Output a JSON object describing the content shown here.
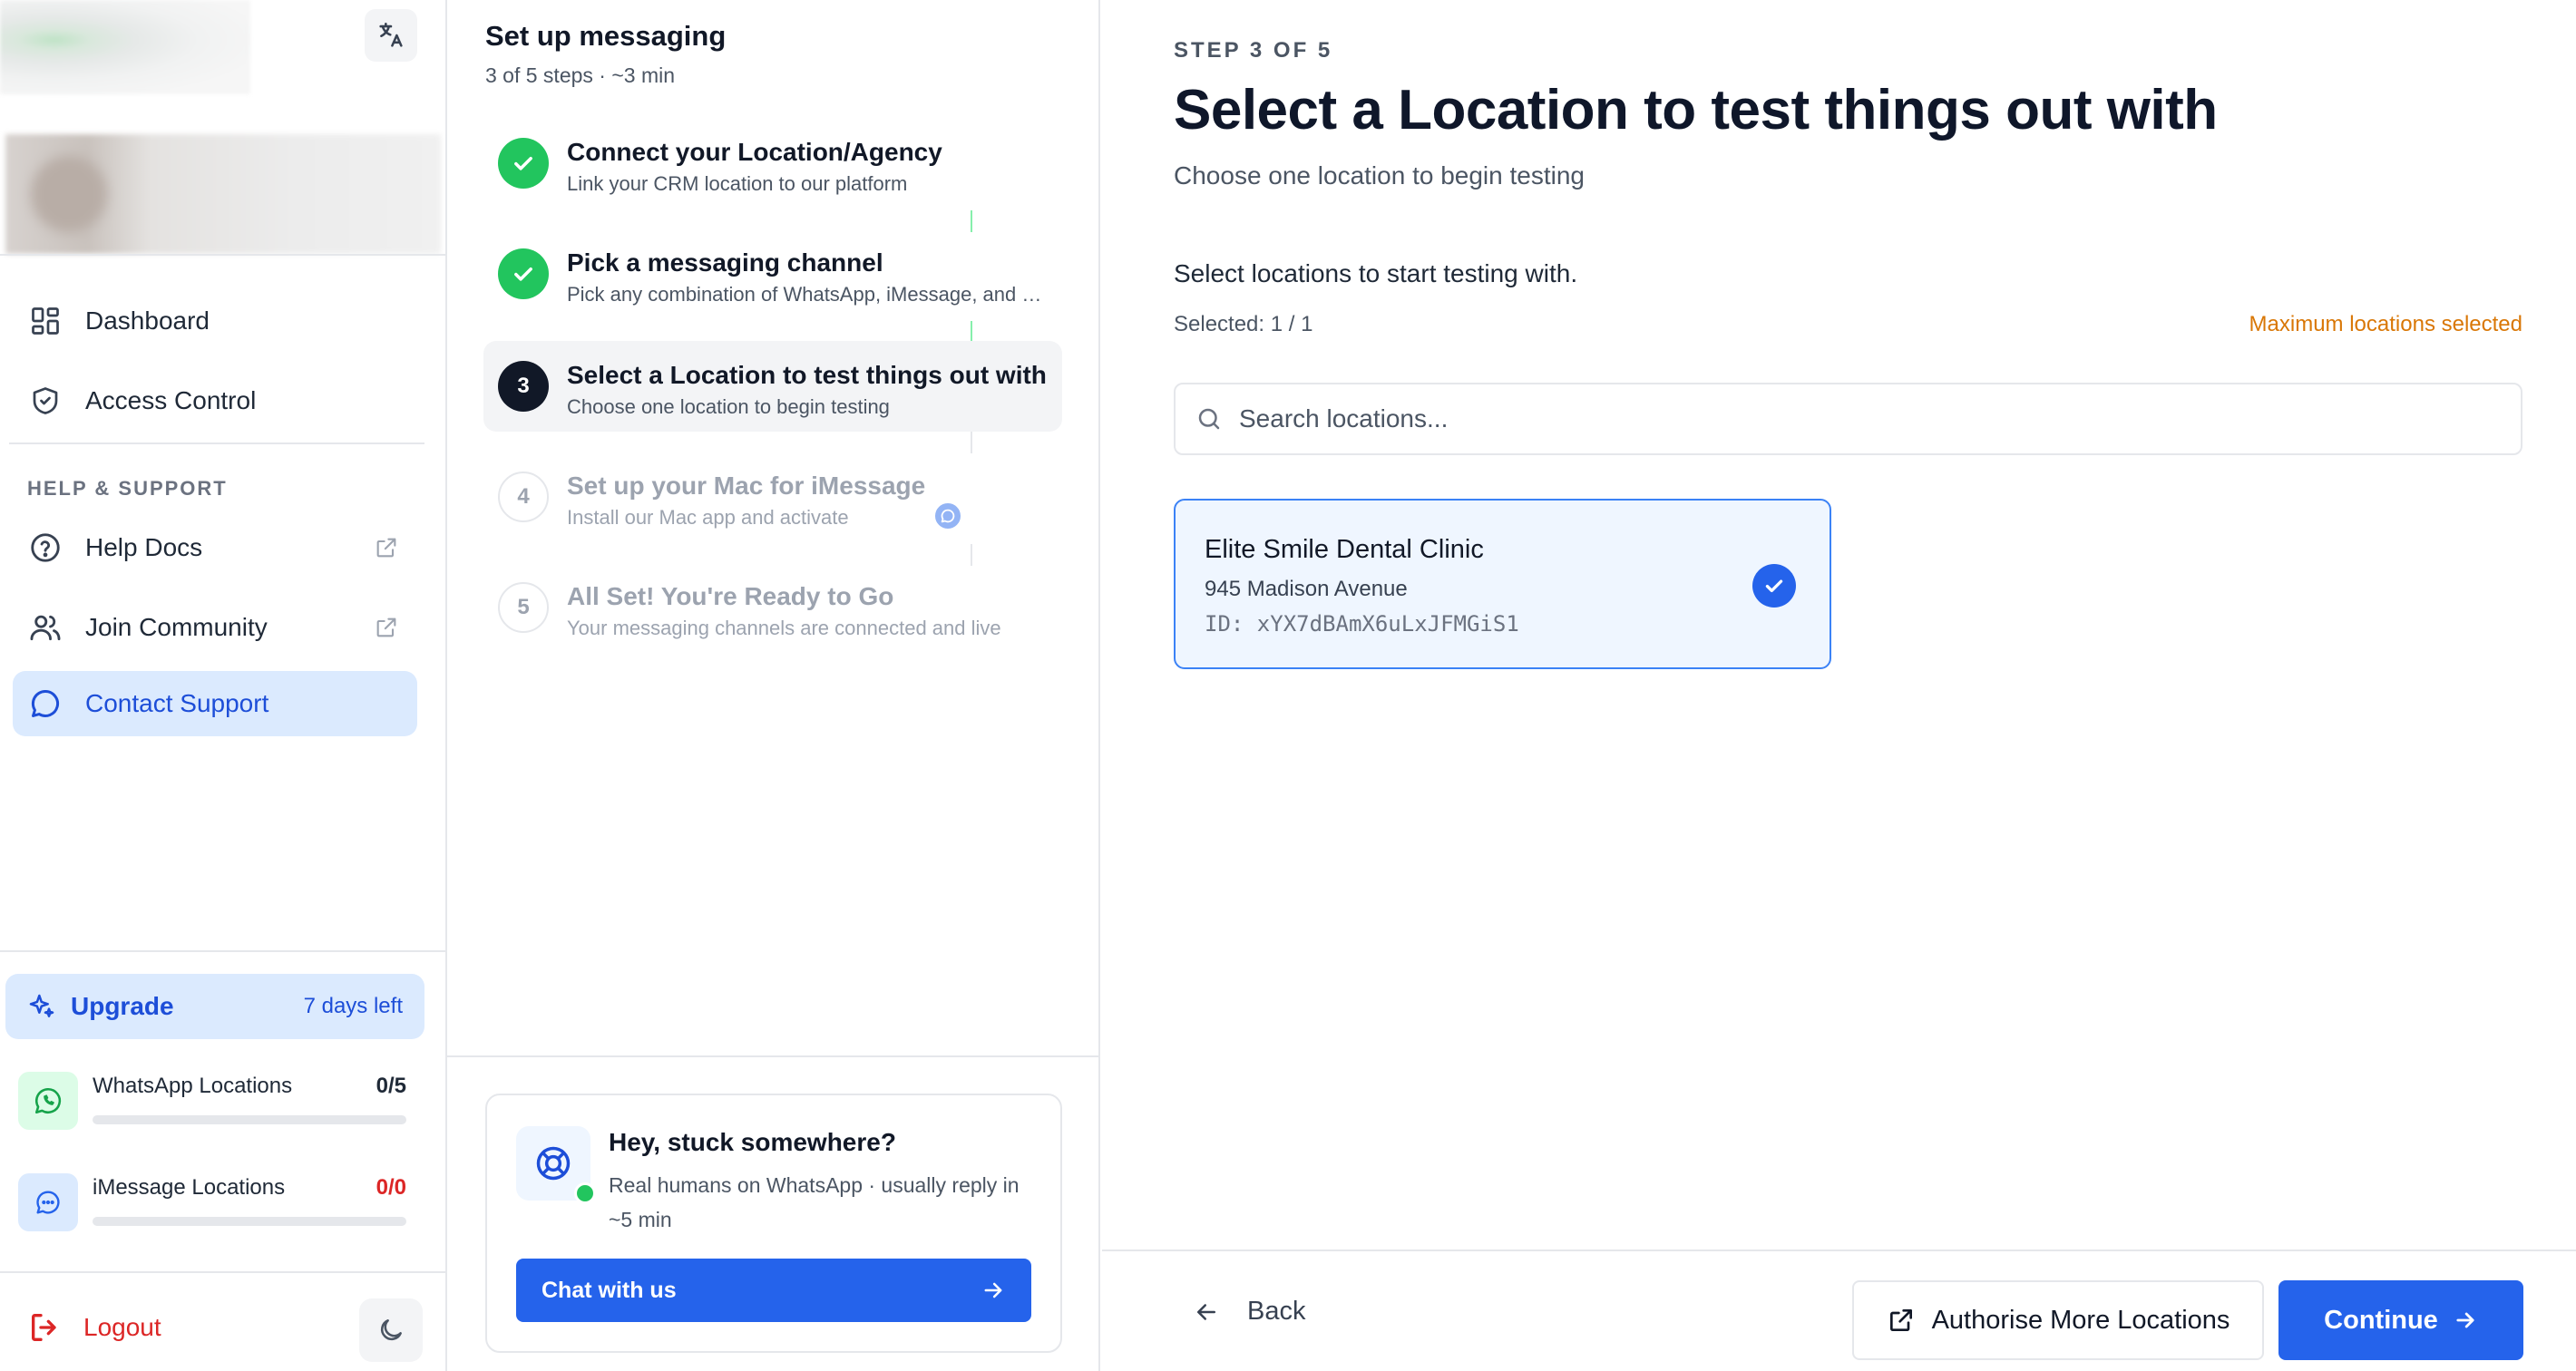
{
  "sidebar": {
    "nav": [
      {
        "label": "Dashboard",
        "icon": "dashboard-grid-icon"
      },
      {
        "label": "Access Control",
        "icon": "shield-check-icon"
      }
    ],
    "section_label": "HELP & SUPPORT",
    "support": [
      {
        "label": "Help Docs",
        "icon": "help-circle-icon",
        "external": true
      },
      {
        "label": "Join Community",
        "icon": "users-icon",
        "external": true
      },
      {
        "label": "Contact Support",
        "icon": "message-circle-icon",
        "active": true
      }
    ],
    "upgrade": {
      "label": "Upgrade",
      "days_left": "7 days left"
    },
    "quotas": [
      {
        "label": "WhatsApp Locations",
        "value": "0/5",
        "used": 0,
        "total": 5
      },
      {
        "label": "iMessage Locations",
        "value": "0/0",
        "used": 0,
        "total": 0
      }
    ],
    "logout_label": "Logout"
  },
  "steps_panel": {
    "title": "Set up messaging",
    "subtitle": "3 of 5 steps · ~3 min",
    "steps": [
      {
        "number": "1",
        "title": "Connect your Location/Agency",
        "desc": "Link your CRM location to our platform",
        "status": "done"
      },
      {
        "number": "2",
        "title": "Pick a messaging channel",
        "desc": "Pick any combination of WhatsApp, iMessage, and more",
        "status": "done"
      },
      {
        "number": "3",
        "title": "Select a Location to test things out with",
        "desc": "Choose one location to begin testing",
        "status": "current"
      },
      {
        "number": "4",
        "title": "Set up your Mac for iMessage",
        "desc": "Install our Mac app and activate",
        "status": "todo"
      },
      {
        "number": "5",
        "title": "All Set! You're Ready to Go",
        "desc": "Your messaging channels are connected and live",
        "status": "todo"
      }
    ],
    "help_card": {
      "title": "Hey, stuck somewhere?",
      "desc": "Real humans on WhatsApp · usually reply in ~5 min",
      "button": "Chat with us"
    }
  },
  "main": {
    "step_label": "STEP 3 OF 5",
    "title": "Select a Location to test things out with",
    "subtitle": "Choose one location to begin testing",
    "select_intro": "Select locations to start testing with.",
    "selected_count": "Selected: 1 / 1",
    "max_notice": "Maximum locations selected",
    "search_placeholder": "Search locations...",
    "locations": [
      {
        "name": "Elite Smile Dental Clinic",
        "address": "945 Madison Avenue",
        "id": "ID: xYX7dBAmX6uLxJFMGiS1",
        "selected": true
      }
    ],
    "footer": {
      "back": "Back",
      "authorise": "Authorise More Locations",
      "continue": "Continue"
    }
  },
  "colors": {
    "accent": "#2563eb",
    "success": "#22c55e",
    "warning": "#d97706",
    "danger": "#dc2626",
    "active_bg": "#dbeafe"
  }
}
